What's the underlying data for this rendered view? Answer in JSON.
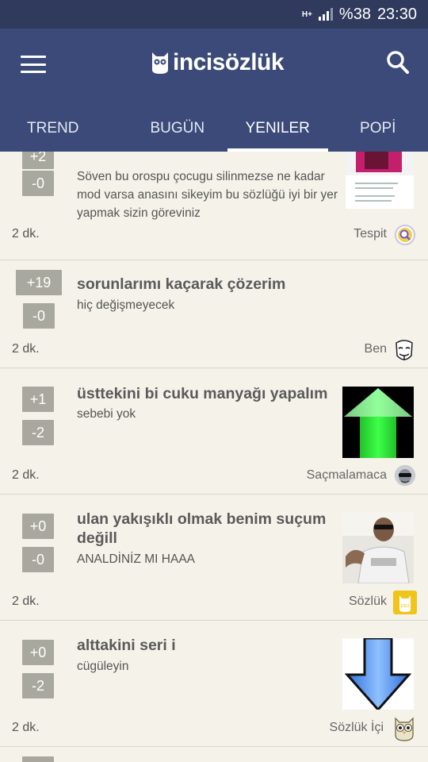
{
  "status_bar": {
    "network": "H+",
    "battery": "%38",
    "time": "23:30"
  },
  "header": {
    "logo_text": "incisözlük"
  },
  "tabs": [
    {
      "label": "TREND",
      "active": false
    },
    {
      "label": "BUGÜN",
      "active": false
    },
    {
      "label": "YENILER",
      "active": true
    },
    {
      "label": "POPİ",
      "active": false
    }
  ],
  "entries": [
    {
      "upvotes": "+2",
      "downvotes": "-0",
      "title": "",
      "body": "Söven bu orospu çocugu silinmezse ne kadar mod varsa anasını sikeyim bu sözlüğü iyi bir yer yapmak sizin göreviniz",
      "time": "2 dk.",
      "author": "Tespit",
      "avatar_icon": "magnifier-badge-icon"
    },
    {
      "upvotes": "+19",
      "downvotes": "-0",
      "title": "sorunlarımı kaçarak çözerim",
      "body": "hiç değişmeyecek",
      "time": "2 dk.",
      "author": "Ben",
      "avatar_icon": "guy-fawkes-mask-icon"
    },
    {
      "upvotes": "+1",
      "downvotes": "-2",
      "title": "üsttekini bi cuku manyağı yapalım",
      "body": "sebebi yok",
      "time": "2 dk.",
      "author": "Saçmalamaca",
      "avatar_icon": "sunglasses-face-icon"
    },
    {
      "upvotes": "+0",
      "downvotes": "-0",
      "title": "ulan yakışıklı olmak benim suçum değill",
      "body": "ANALDİNİZ MI HAAA",
      "time": "2 dk.",
      "author": "Sözlük",
      "avatar_icon": "inci-owl-badge-icon",
      "avatar_text": "inci"
    },
    {
      "upvotes": "+0",
      "downvotes": "-2",
      "title": "alttakini seri i",
      "body": "cügüleyin",
      "time": "2 dk.",
      "author": "Sözlük İçi",
      "avatar_icon": "owl-icon"
    }
  ],
  "colors": {
    "appbar": "#3b4a78",
    "statusbar": "#2f3a5c",
    "background": "#f4f2e9",
    "vote_button": "#a9a89e"
  }
}
